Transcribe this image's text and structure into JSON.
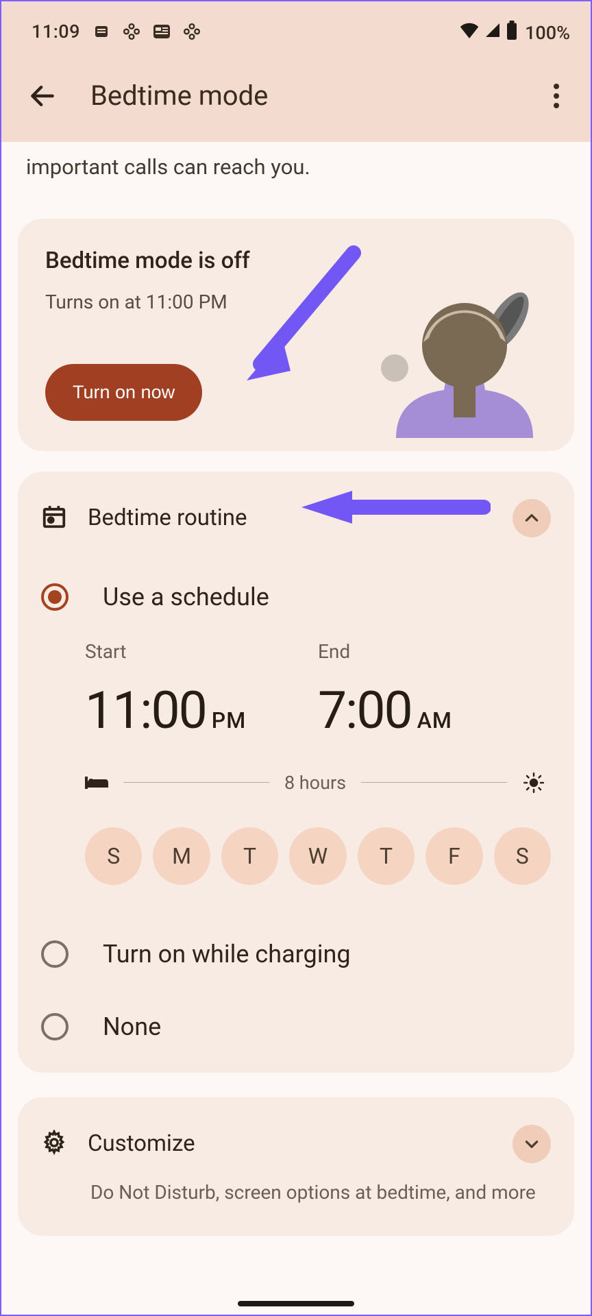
{
  "status_bar": {
    "time": "11:09",
    "battery": "100%"
  },
  "app_bar": {
    "title": "Bedtime mode"
  },
  "intro": "important calls can reach you.",
  "status_card": {
    "title": "Bedtime mode is off",
    "subtitle": "Turns on at 11:00 PM",
    "button": "Turn on now"
  },
  "routine": {
    "title": "Bedtime routine",
    "options": {
      "schedule": "Use a schedule",
      "charging": "Turn on while charging",
      "none": "None"
    },
    "start_label": "Start",
    "end_label": "End",
    "start_time": "11:00",
    "start_ampm": "PM",
    "end_time": "7:00",
    "end_ampm": "AM",
    "duration": "8 hours",
    "days": [
      "S",
      "M",
      "T",
      "W",
      "T",
      "F",
      "S"
    ]
  },
  "customize": {
    "title": "Customize",
    "subtitle": "Do Not Disturb, screen options at bedtime, and more"
  }
}
